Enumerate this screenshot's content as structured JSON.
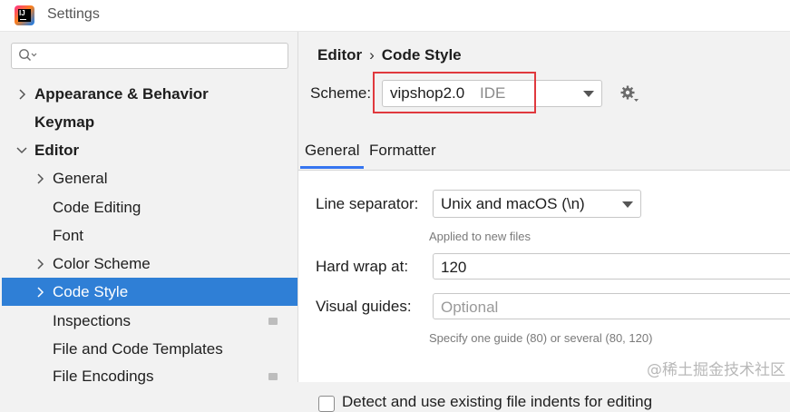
{
  "window": {
    "title": "Settings",
    "app_icon": "intellij-idea-icon"
  },
  "sidebar": {
    "search": {
      "icon": "search-icon"
    },
    "items": [
      {
        "label": "Appearance & Behavior",
        "expandable": true,
        "bold": true
      },
      {
        "label": "Keymap",
        "expandable": false,
        "bold": true
      },
      {
        "label": "Editor",
        "expandable": true,
        "expanded": true,
        "bold": true
      },
      {
        "label": "General",
        "expandable": true
      },
      {
        "label": "Code Editing",
        "expandable": false
      },
      {
        "label": "Font",
        "expandable": false
      },
      {
        "label": "Color Scheme",
        "expandable": true
      },
      {
        "label": "Code Style",
        "expandable": true,
        "selected": true
      },
      {
        "label": "Inspections",
        "expandable": false
      },
      {
        "label": "File and Code Templates",
        "expandable": false
      },
      {
        "label": "File Encodings",
        "expandable": false
      }
    ]
  },
  "main": {
    "breadcrumb": {
      "parent": "Editor",
      "separator": "›",
      "current": "Code Style"
    },
    "scheme": {
      "label": "Scheme:",
      "value": "vipshop2.0",
      "hint": "IDE"
    },
    "tabs": [
      {
        "label": "General",
        "active": true
      },
      {
        "label": "Formatter"
      }
    ],
    "line_separator": {
      "label": "Line separator:",
      "value": "Unix and macOS (\\n)",
      "hint": "Applied to new files"
    },
    "hard_wrap": {
      "label": "Hard wrap at:",
      "value": "120"
    },
    "visual_guides": {
      "label": "Visual guides:",
      "placeholder": "Optional",
      "hint": "Specify one guide (80) or several (80, 120)"
    },
    "detect_indents": {
      "label": "Detect and use existing file indents for editing",
      "checked": false
    }
  },
  "watermark": "@稀土掘金技术社区",
  "colors": {
    "accent": "#2f7fd6",
    "tab_underline": "#3574f0",
    "highlight_box": "#e0393e"
  }
}
